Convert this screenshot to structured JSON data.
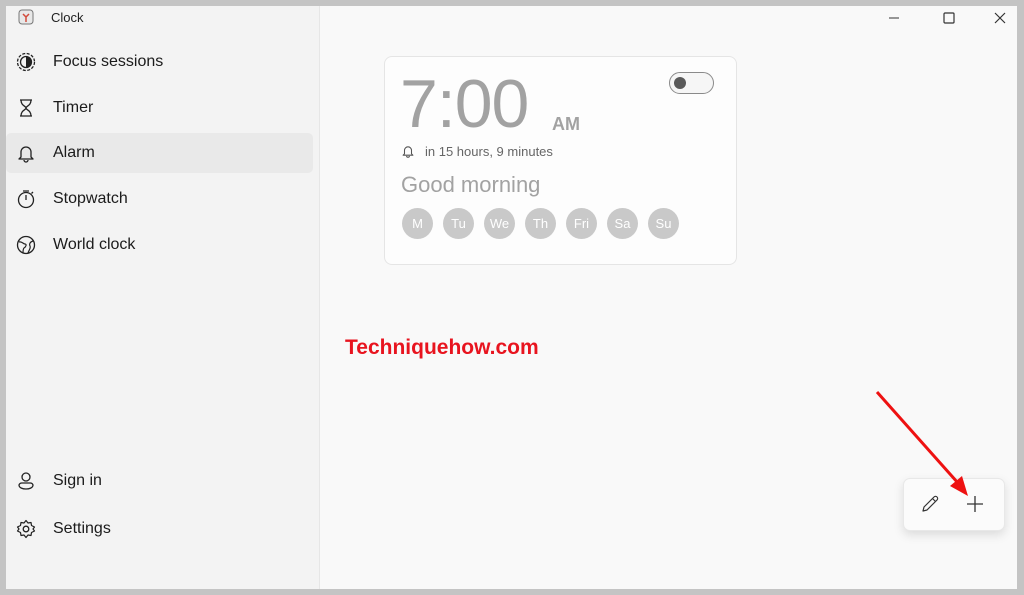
{
  "app": {
    "title": "Clock",
    "icon": "clock-app-icon"
  },
  "window_controls": {
    "minimize": "minimize-icon",
    "maximize": "maximize-icon",
    "close": "close-icon"
  },
  "sidebar": {
    "items": [
      {
        "label": "Focus sessions",
        "icon": "focus-icon",
        "active": false
      },
      {
        "label": "Timer",
        "icon": "hourglass-icon",
        "active": false
      },
      {
        "label": "Alarm",
        "icon": "bell-icon",
        "active": true
      },
      {
        "label": "Stopwatch",
        "icon": "stopwatch-icon",
        "active": false
      },
      {
        "label": "World clock",
        "icon": "globe-icon",
        "active": false
      }
    ],
    "footer": [
      {
        "label": "Sign in",
        "icon": "person-icon"
      },
      {
        "label": "Settings",
        "icon": "gear-icon"
      }
    ]
  },
  "alarm": {
    "time": "7:00",
    "ampm": "AM",
    "enabled": false,
    "remaining": "in 15 hours, 9 minutes",
    "name": "Good morning",
    "days": [
      "M",
      "Tu",
      "We",
      "Th",
      "Fri",
      "Sa",
      "Su"
    ]
  },
  "watermark": {
    "text": "Techniquehow.com",
    "color": "#e8141f"
  },
  "actions": {
    "edit": "pencil-icon",
    "add": "plus-icon"
  },
  "annotation": {
    "type": "red-arrow",
    "color": "#ee1111",
    "target": "add-alarm-button"
  }
}
